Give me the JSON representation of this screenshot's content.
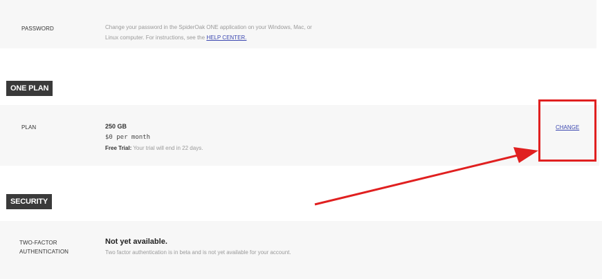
{
  "password": {
    "label": "PASSWORD",
    "desc_line1": "Change your password in the SpiderOak ONE application on your Windows, Mac, or",
    "desc_line2": "Linux computer. For instructions, see the",
    "link": "HELP CENTER."
  },
  "one_plan": {
    "header": "ONE PLAN",
    "label": "PLAN",
    "size": "250 GB",
    "price": "$0 per month",
    "trial_label": "Free Trial:",
    "trial_text": "Your trial will end in 22 days.",
    "change_link": "CHANGE"
  },
  "security": {
    "header": "SECURITY",
    "label_line1": "TWO-FACTOR",
    "label_line2": "AUTHENTICATION",
    "title": "Not yet available.",
    "desc": "Two factor authentication is in beta and is not yet available for your account."
  },
  "colors": {
    "annotation": "#e02020",
    "link": "#3b47b0",
    "header_bg": "#3a3a3a"
  }
}
